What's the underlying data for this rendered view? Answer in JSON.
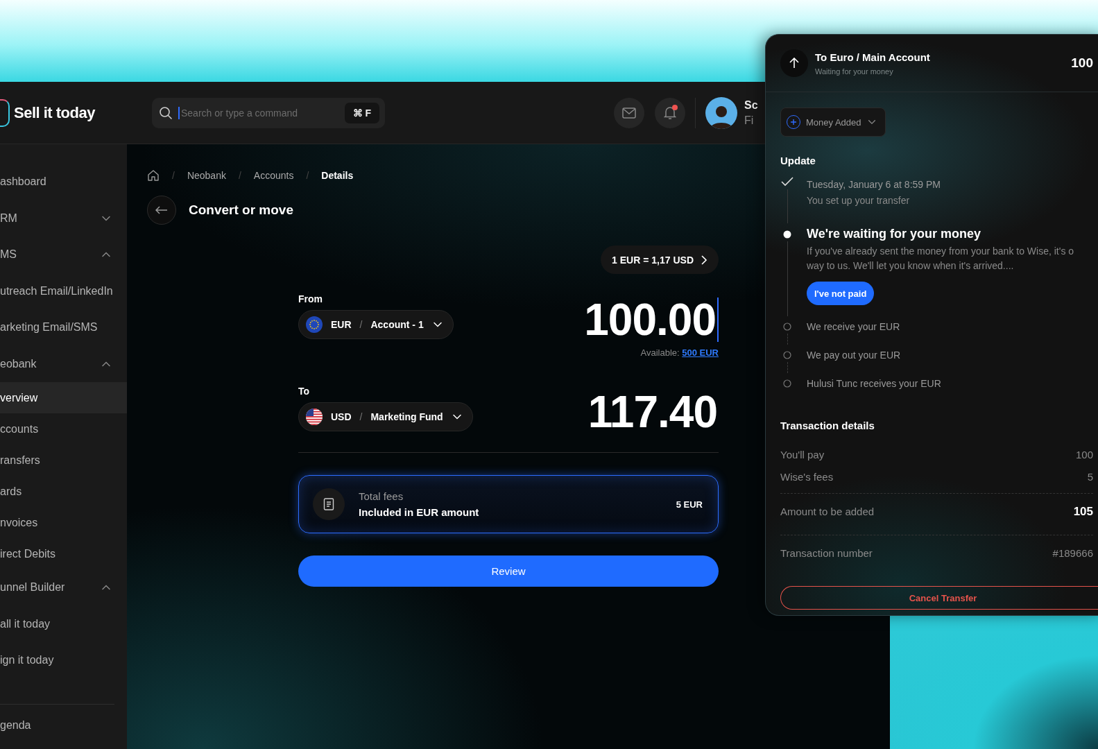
{
  "header": {
    "logo": "Sell it today",
    "search": {
      "placeholder": "Search or type a command",
      "shortcut": "⌘ F"
    },
    "notifications": {
      "unread": true
    },
    "user": {
      "name": "Sc",
      "role": "Fi"
    }
  },
  "sidebar": {
    "items": [
      {
        "label": "ashboard",
        "selected": false
      },
      {
        "label": "RM",
        "expanded": false,
        "selected": false
      },
      {
        "label": "MS",
        "expanded": true,
        "selected": false
      },
      {
        "label": "utreach Email/LinkedIn",
        "selected": false
      },
      {
        "label": "arketing Email/SMS",
        "selected": false
      },
      {
        "label": "eobank",
        "expanded": true,
        "selected": false
      },
      {
        "label": "verview",
        "selected": true,
        "sub": true
      },
      {
        "label": "ccounts",
        "selected": false,
        "sub": true
      },
      {
        "label": "ransfers",
        "selected": false,
        "sub": true
      },
      {
        "label": "ards",
        "selected": false,
        "sub": true
      },
      {
        "label": "nvoices",
        "selected": false,
        "sub": true
      },
      {
        "label": "irect Debits",
        "selected": false,
        "sub": true
      },
      {
        "label": "unnel Builder",
        "expanded": true,
        "selected": false
      },
      {
        "label": "all it today",
        "selected": false
      },
      {
        "label": "ign it today",
        "selected": false
      }
    ],
    "footer_items": [
      {
        "label": "genda",
        "selected": false
      }
    ]
  },
  "breadcrumb_separator": "/",
  "breadcrumb": [
    {
      "label": "Neobank",
      "current": false
    },
    {
      "label": "Accounts",
      "current": false
    },
    {
      "label": "Details",
      "current": true
    }
  ],
  "page_title": "Convert or move",
  "rate": "1 EUR = 1,17 USD",
  "accounts": [
    {
      "label": "From",
      "currency": "EUR",
      "separator": "/",
      "account": "Account - 1",
      "amount": "100.00",
      "caret": true,
      "available_label": "Available:",
      "available_value": "500 EUR"
    },
    {
      "label": "To",
      "currency": "USD",
      "separator": "/",
      "account": "Marketing Fund",
      "amount": "117.40",
      "caret": false
    }
  ],
  "fees": {
    "title": "Total fees",
    "subtitle": "Included in EUR amount",
    "value": "5 EUR"
  },
  "review_button": "Review",
  "transfer_panel": {
    "title": "To Euro / Main Account",
    "subtitle": "Waiting for your money",
    "amount": "100",
    "status_dropdown": "Money Added",
    "update_heading": "Update",
    "steps": [
      {
        "kind": "done",
        "title": "Tuesday, January 6 at 8:59 PM",
        "text": "You set up your transfer"
      },
      {
        "kind": "current",
        "title": "We're waiting for your money",
        "lines": [
          "If you've already sent the money from your bank to Wise, it's o",
          "way to us. We'll let you know when it's arrived...."
        ],
        "button": "I've not paid"
      },
      {
        "kind": "pending",
        "title": "We receive your EUR"
      },
      {
        "kind": "pending",
        "title": "We pay out your EUR"
      },
      {
        "kind": "pending",
        "title": "Hulusi Tunc receives your EUR"
      }
    ],
    "details_heading": "Transaction details",
    "details": [
      {
        "label": "You'll pay",
        "value": "100",
        "emphasis": false,
        "divider_before": false
      },
      {
        "label": "Wise's fees",
        "value": "5",
        "emphasis": false,
        "divider_before": false
      },
      {
        "label": "Amount to be added",
        "value": "105",
        "emphasis": true,
        "divider_before": true
      },
      {
        "label": "Transaction number",
        "value": "#189666",
        "emphasis": false,
        "divider_before": true
      }
    ],
    "cancel_button": "Cancel Transfer"
  }
}
